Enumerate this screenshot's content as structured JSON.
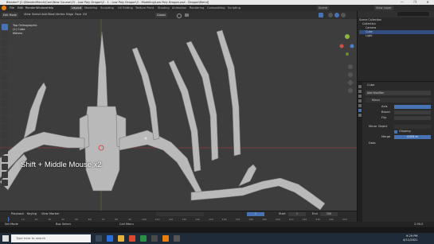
{
  "window": {
    "title": "Blender* [C:\\BlenderMerch\\Com\\New Course\\15 - Low Poly Dragon\\2 - 1 - Low Poly Dragon\\3 - Modeling\\Low Poly Dragon.psd - Dragon\\Blend]",
    "controls": [
      "—",
      "❐",
      "✕"
    ]
  },
  "menubar": {
    "items": [
      "File",
      "Edit",
      "Render",
      "Window",
      "Help"
    ],
    "workspaces": [
      "Layout",
      "Modeling",
      "Sculpting",
      "UV Editing",
      "Texture Paint",
      "Shading",
      "Animation",
      "Rendering",
      "Compositing",
      "Scripting"
    ],
    "active_workspace": "Layout",
    "scene": "Scene",
    "view_layer": "View Layer"
  },
  "viewport_header": {
    "mode": "Edit Mode",
    "menus": [
      "View",
      "Select",
      "Add",
      "Mesh",
      "Vertex",
      "Edge",
      "Face",
      "UV"
    ],
    "orientation": "Global"
  },
  "viewport": {
    "view_name": "Top Orthographic",
    "collection": "(1) Cube",
    "units": "Meters",
    "overlay_hint": "Shift + Middle Mouse x2"
  },
  "outliner": {
    "rows": [
      {
        "label": "Scene Collection",
        "selected": false
      },
      {
        "label": "Collection",
        "selected": false
      },
      {
        "label": "Camera",
        "selected": false
      },
      {
        "label": "Cube",
        "selected": true
      },
      {
        "label": "Light",
        "selected": false
      }
    ]
  },
  "properties": {
    "object_name": "Cube",
    "add_modifier": "Add Modifier",
    "modifier": "Mirror",
    "axis_label": "Axis",
    "bisect_label": "Bisect",
    "flip_label": "Flip",
    "mirror_object": "Mirror Object",
    "clipping": "Clipping",
    "merge_label": "Merge",
    "merge_value": "0.001 m",
    "data_label": "Data"
  },
  "timeline": {
    "menus": [
      "Playback",
      "Keying",
      "View",
      "Marker"
    ],
    "current_frame": "1",
    "start_label": "Start",
    "start": "1",
    "end_label": "End",
    "end": "250",
    "ticks": [
      "0",
      "10",
      "20",
      "30",
      "40",
      "50",
      "60",
      "70",
      "80",
      "90",
      "100",
      "110",
      "120",
      "130",
      "140",
      "150",
      "160",
      "170",
      "180",
      "190",
      "200",
      "210",
      "220",
      "230",
      "240",
      "250"
    ]
  },
  "status": {
    "left": "Set Mode",
    "middle": "Box Select",
    "right": "Call Menu",
    "version": "2.90.0"
  },
  "taskbar": {
    "search_placeholder": "Type here to search",
    "time": "9:29 PM",
    "date": "4/11/2021"
  }
}
